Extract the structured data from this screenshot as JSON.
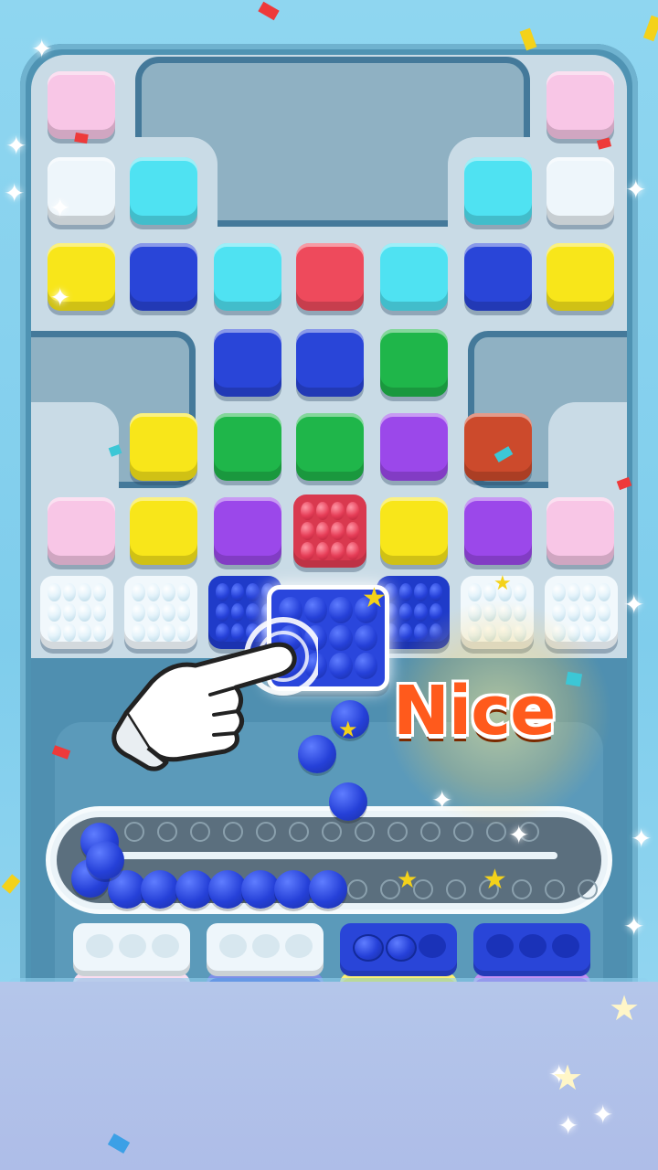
{
  "banner": {
    "text": "Nice"
  },
  "colors": {
    "pink": "#f8c6e6",
    "white": "#eef6fb",
    "cyan": "#4fe2f2",
    "yellow": "#f8e61a",
    "blue": "#2945d8",
    "red": "#ee4a5c",
    "green": "#1fb64a",
    "purple": "#9b48ea",
    "orange": "#cc4a2c"
  },
  "grid": {
    "row1": [
      "pink",
      "pink"
    ],
    "row2": [
      "white",
      "cyan",
      "cyan",
      "white"
    ],
    "row3": [
      "yellow",
      "blue",
      "cyan",
      "red",
      "cyan",
      "blue",
      "yellow"
    ],
    "row4": [
      "blue",
      "blue",
      "green"
    ],
    "row5": [
      "yellow",
      "green",
      "green",
      "purple",
      "orange"
    ],
    "row6": [
      "pink",
      "yellow",
      "purple",
      "red-balls",
      "yellow",
      "purple",
      "pink"
    ],
    "row7": [
      "white-balls",
      "white-balls",
      "blue-balls",
      "blue-balls",
      "white-balls",
      "white-balls"
    ]
  },
  "conveyor": {
    "balls_on_track": 10,
    "total_slots": 30
  },
  "bins": [
    {
      "color": "white",
      "base": "pink",
      "filled": 0,
      "capacity": 3
    },
    {
      "color": "white",
      "base": "blue",
      "filled": 0,
      "capacity": 3
    },
    {
      "color": "blue",
      "base": "yellow",
      "filled": 2,
      "capacity": 3
    },
    {
      "color": "blue",
      "base": "purple",
      "filled": 0,
      "capacity": 3
    }
  ],
  "icons": [
    "pointing-hand-icon",
    "sparkle-icon",
    "star-icon"
  ]
}
